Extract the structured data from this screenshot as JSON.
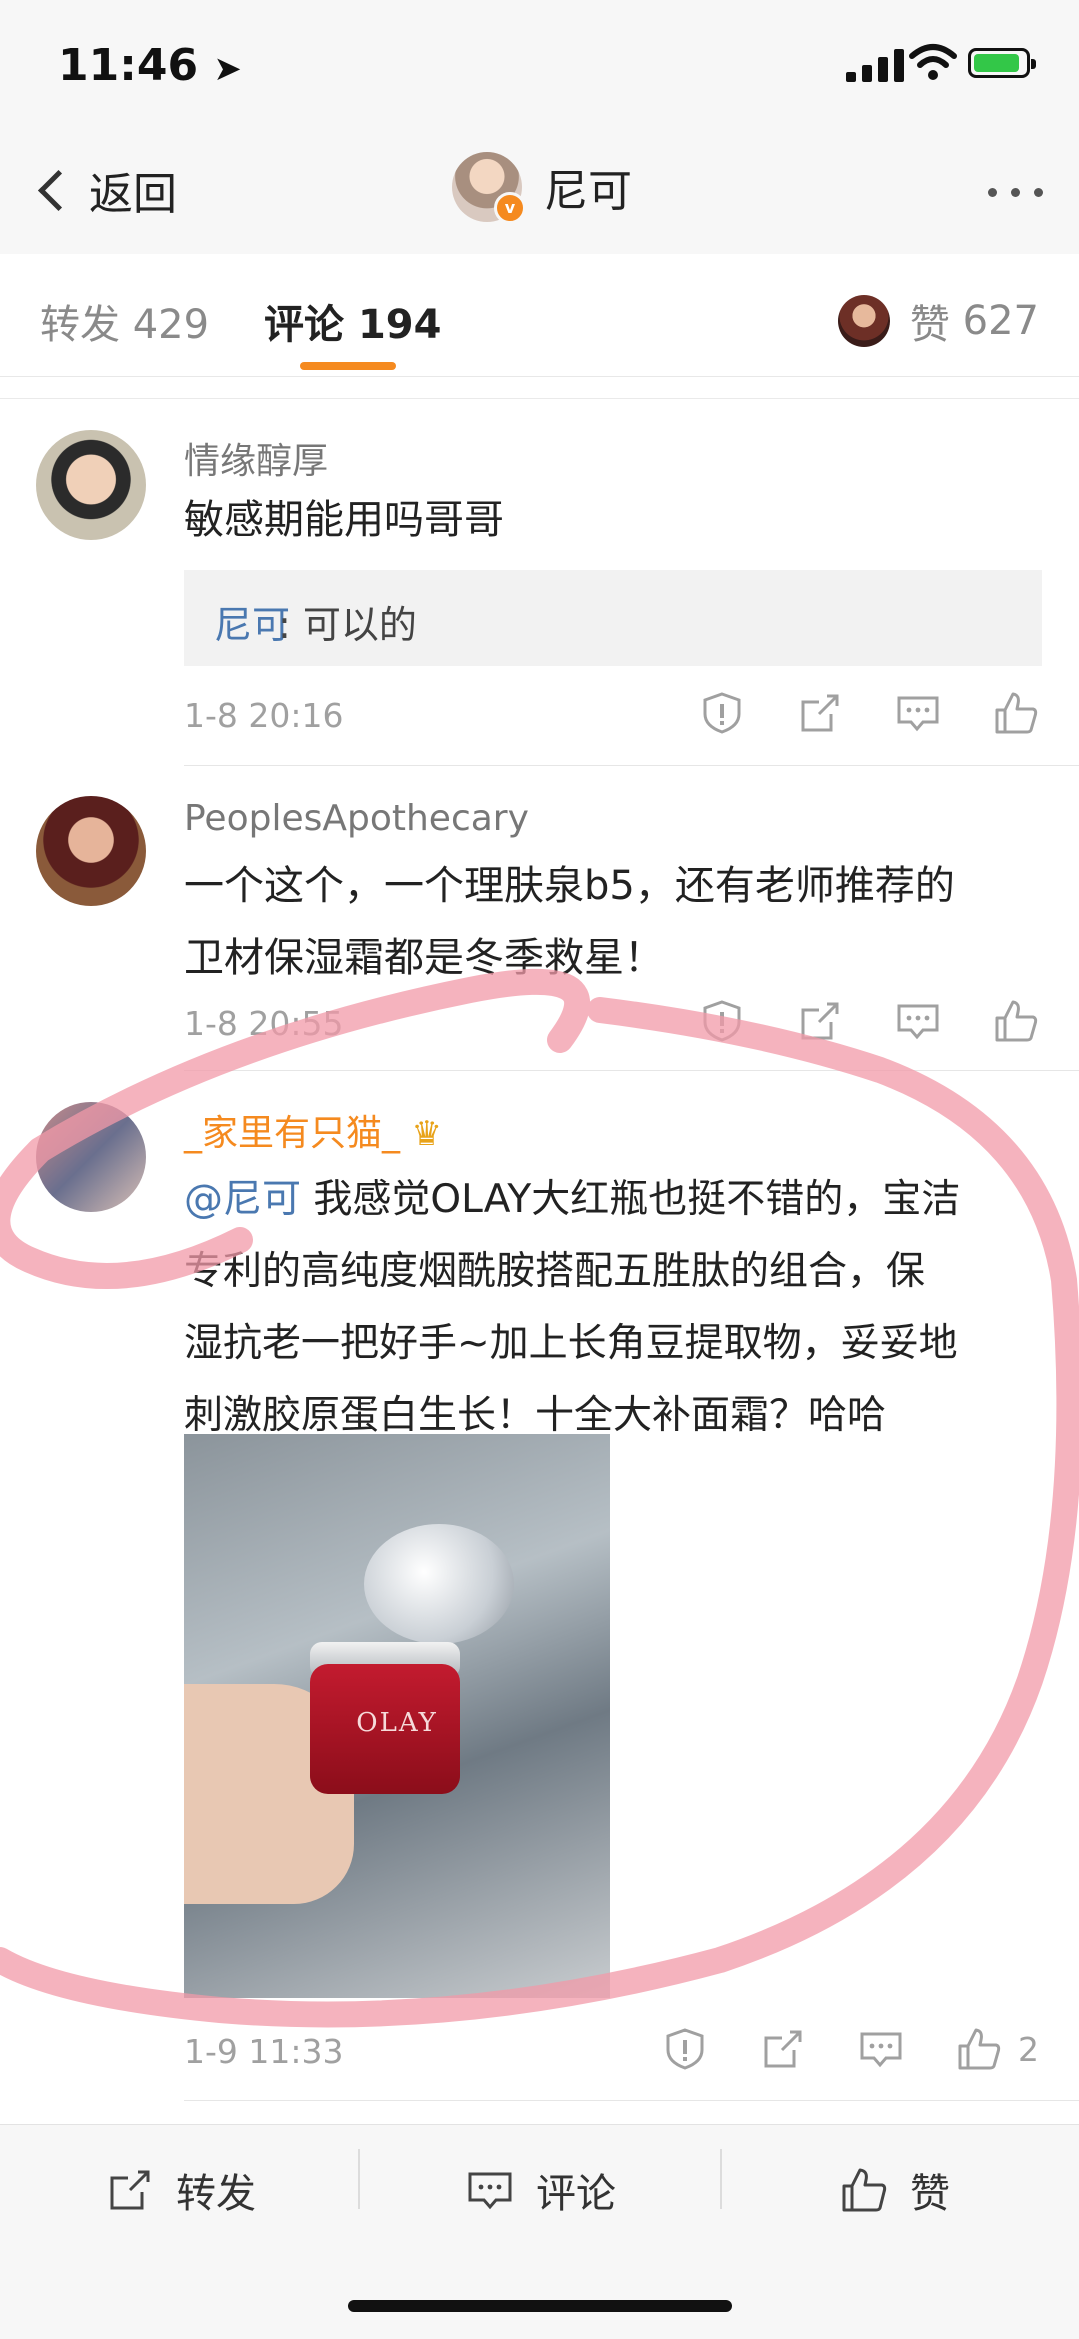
{
  "status_bar": {
    "time": "11:46",
    "location_arrow": "location-arrow-icon",
    "battery_color": "#33c748"
  },
  "nav": {
    "back_label": "返回",
    "title": "尼可",
    "verified_badge": "v"
  },
  "tabs": {
    "repost_label": "转发",
    "repost_count": "429",
    "comment_label": "评论",
    "comment_count": "194",
    "likes_label": "赞",
    "likes_count": "627",
    "accent_color": "#f58a1f"
  },
  "comments": [
    {
      "author": "情缘醇厚",
      "text": "敏感期能用吗哥哥",
      "reply": {
        "author": "尼可",
        "text": ": 可以的"
      },
      "time": "1-8 20:16"
    },
    {
      "author": "PeoplesApothecary",
      "text_line1": "一个这个，一个理肤泉b5，还有老师推荐的",
      "text_line2": "卫材保湿霜都是冬季救星！",
      "time": "1-8 20:55"
    },
    {
      "author": "_家里有只猫_",
      "mention": "@尼可",
      "text_line1": " 我感觉OLAY大红瓶也挺不错的，宝洁",
      "text_line2": "专利的高纯度烟酰胺搭配五胜肽的组合，保",
      "text_line3": "湿抗老一把好手~加上长角豆提取物，妥妥地",
      "text_line4": "刺激胶原蛋白生长！十全大补面霜？哈哈",
      "time": "1-9 11:33",
      "like_count": "2",
      "photo_brand": "OLAY"
    }
  ],
  "bottom_bar": {
    "repost": "转发",
    "comment": "评论",
    "like": "赞"
  }
}
